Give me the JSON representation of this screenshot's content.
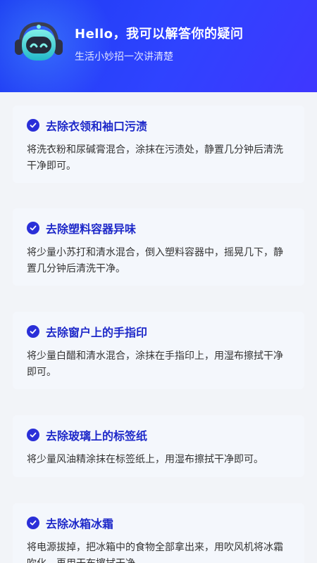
{
  "header": {
    "title": "Hello，我可以解答你的疑问",
    "subtitle": "生活小妙招一次讲清楚"
  },
  "cards": [
    {
      "title": "去除衣领和袖口污渍",
      "body": "将洗衣粉和尿碱膏混合，涂抹在污渍处，静置几分钟后清洗干净即可。"
    },
    {
      "title": "去除塑料容器异味",
      "body": "将少量小苏打和清水混合，倒入塑料容器中，摇晃几下，静置几分钟后清洗干净。"
    },
    {
      "title": "去除窗户上的手指印",
      "body": "将少量白醋和清水混合，涂抹在手指印上，用湿布擦拭干净即可。"
    },
    {
      "title": "去除玻璃上的标签纸",
      "body": "将少量风油精涂抹在标签纸上，用湿布擦拭干净即可。"
    },
    {
      "title": "去除冰箱冰霜",
      "body": "将电源拔掉，把冰箱中的食物全部拿出来，用吹风机将冰霜吹化，再用干布擦拭干净。"
    }
  ],
  "colors": {
    "accent": "#1e29c9",
    "header": "#2f43ff"
  }
}
